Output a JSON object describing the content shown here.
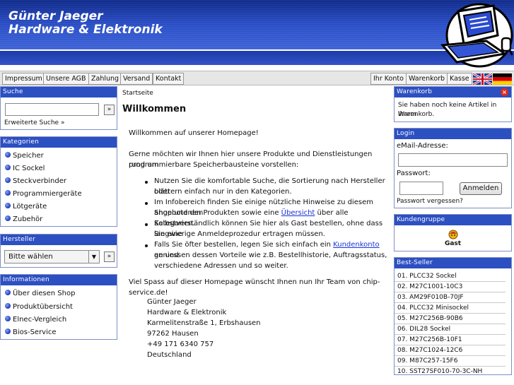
{
  "header": {
    "title_line1": "Günter Jaeger",
    "title_line2": "Hardware & Elektronik"
  },
  "nav": {
    "left": [
      "Impressum",
      "Unsere AGB",
      "Zahlung",
      "Versand",
      "Kontakt"
    ],
    "right": [
      "Ihr Konto",
      "Warenkorb",
      "Kasse"
    ]
  },
  "search": {
    "heading": "Suche",
    "go": "»",
    "advanced": "Erweiterte Suche »"
  },
  "categories": {
    "heading": "Kategorien",
    "items": [
      "Speicher",
      "IC Sockel",
      "Steckverbinder",
      "Programmiergeräte",
      "Lötgeräte",
      "Zubehör"
    ]
  },
  "manufacturer": {
    "heading": "Hersteller",
    "selected": "Bitte wählen",
    "go": "»"
  },
  "info": {
    "heading": "Informationen",
    "items": [
      "Über diesen Shop",
      "Produktübersicht",
      "Elnec-Vergleich",
      "Bios-Service"
    ]
  },
  "main": {
    "breadcrumb": "Startseite",
    "title": "Willkommen",
    "p1": "Willkommen auf unserer Homepage!",
    "p2a": "Gerne möchten wir Ihnen hier unsere Produkte und Dienstleistungen rund um",
    "p2b": "programmierbare Speicherbausteine vorstellen:",
    "b1a": "Nutzen Sie die komfortable Suche, die Sortierung nach Hersteller oder",
    "b1b": "blättern einfach nur in den Kategorien.",
    "b2a": "Im Infobereich finden Sie einige nützliche Hinweise zu diesem Shop und den",
    "b2b_pre": "angebotenen Produkten sowie eine ",
    "b2b_link": "Übersicht",
    "b2b_post": " über alle Kategorien.",
    "b3a": "Selbstverständlich können Sie hier als Gast bestellen, ohne dass Sie eine",
    "b3b": "langwierige Anmeldeprozedur ertragen müssen.",
    "b4a_pre": "Falls Sie öfter bestellen, legen Sie sich einfach ein ",
    "b4a_link": "Kundenkonto",
    "b4a_post": " an und",
    "b4b": "geniessen dessen Vorteile wie z.B. Bestellhistorie, Auftragsstatus,",
    "b4c": "verschiedene Adressen und so weiter.",
    "p3": "Viel Spass auf dieser Homepage wünscht Ihnen nun Ihr Team von chip-service.de!",
    "address": [
      "Günter Jaeger",
      "Hardware & Elektronik",
      "Karmelitenstraße 1, Erbshausen",
      "97262 Hausen",
      "+49 171 6340 757",
      "Deutschland"
    ]
  },
  "cart": {
    "heading": "Warenkorb",
    "text1": "Sie haben noch keine Artikel in Ihrem",
    "text2": "Warenkorb."
  },
  "login": {
    "heading": "Login",
    "email_label": "eMail-Adresse:",
    "password_label": "Passwort:",
    "button": "Anmelden",
    "forgot": "Passwort vergessen?"
  },
  "customer_group": {
    "heading": "Kundengruppe",
    "value": "Gast"
  },
  "bestseller": {
    "heading": "Best-Seller",
    "items": [
      "01. PLCC32 Sockel",
      "02. M27C1001-10C3",
      "03. AM29F010B-70JF",
      "04. PLCC32 Minisockel",
      "05. M27C256B-90B6",
      "06. DIL28 Sockel",
      "07. M27C256B-10F1",
      "08. M27C1024-12C6",
      "09. M87C257-15F6",
      "10. SST27SF010-70-3C-NH"
    ]
  }
}
